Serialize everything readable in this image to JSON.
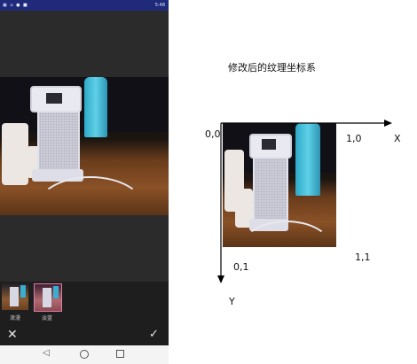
{
  "phone": {
    "filters": [
      {
        "label": "浪漫",
        "selected": false
      },
      {
        "label": "淡蓝",
        "selected": true
      }
    ],
    "statusbar_text": "5:48",
    "icons": {
      "close": "close-icon",
      "confirm": "check-icon",
      "back": "back-icon",
      "home": "home-icon",
      "recent": "recent-apps-icon"
    },
    "accent": "#1f2a7a"
  },
  "diagram": {
    "title": "修改后的纹理坐标系",
    "origin_label": "0,0",
    "x_label": "X",
    "y_label": "Y",
    "corner_10": "1,0",
    "corner_01": "0,1",
    "corner_11": "1,1"
  }
}
